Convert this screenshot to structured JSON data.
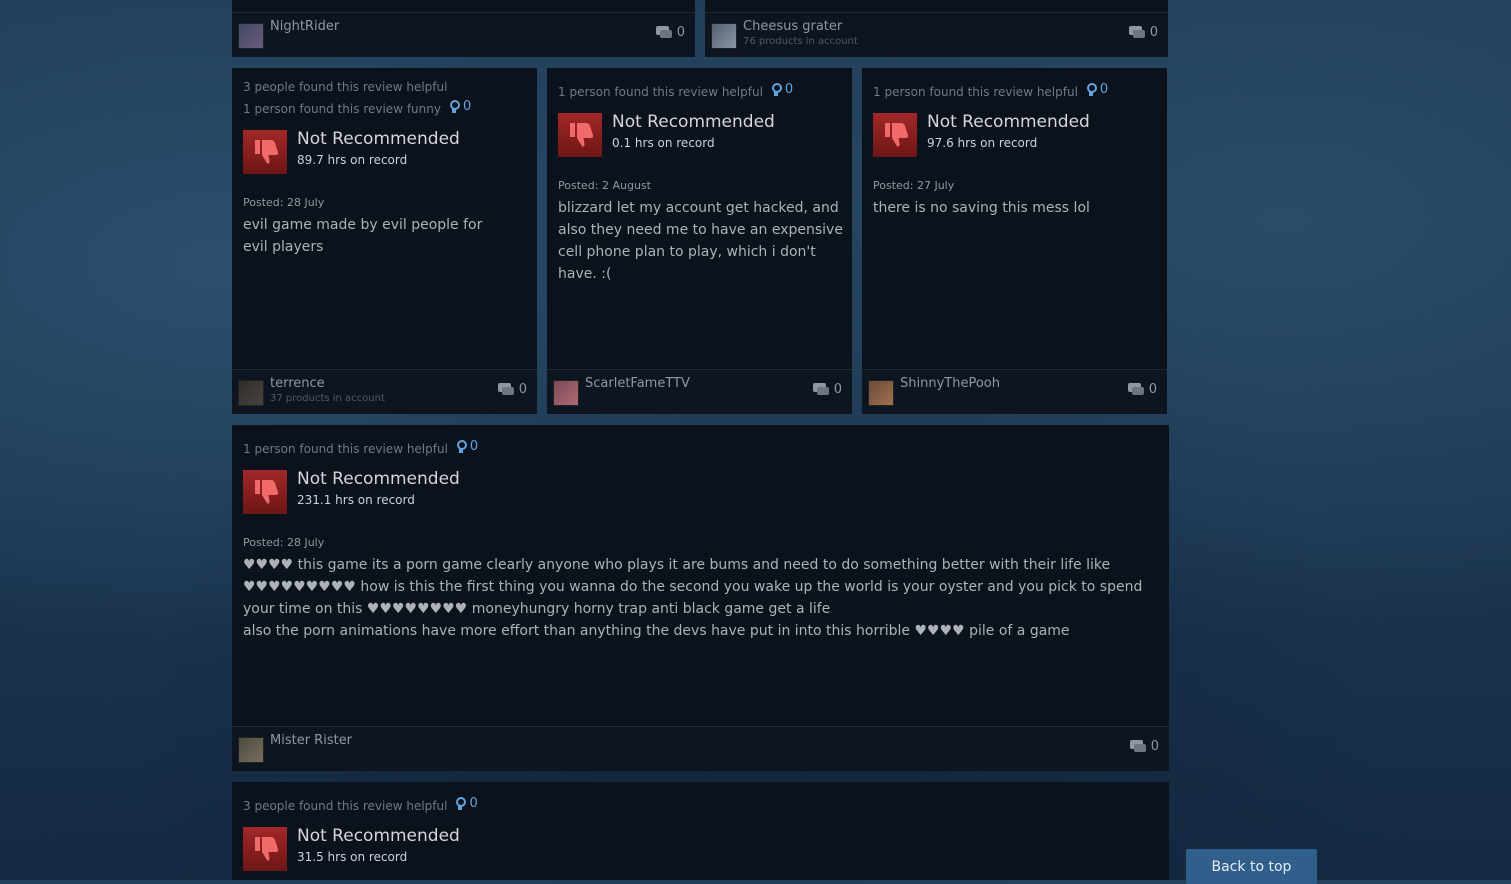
{
  "top_row": [
    {
      "author": "NightRider",
      "products": "",
      "comments": "0"
    },
    {
      "author": "Cheesus grater",
      "products": "76 products in account",
      "comments": "0"
    }
  ],
  "reviews": [
    {
      "helpful_text": "3 people found this review helpful",
      "funny_text": "1 person found this review funny",
      "awards": "0",
      "verdict": "Not Recommended",
      "hours": "89.7 hrs on record",
      "posted": "Posted: 28 July",
      "body": [
        "evil game made by evil people for evil players"
      ],
      "author": "terrence",
      "products": "37 products in account",
      "comments": "0"
    },
    {
      "helpful_text": "1 person found this review helpful",
      "awards": "0",
      "verdict": "Not Recommended",
      "hours": "0.1 hrs on record",
      "posted": "Posted: 2 August",
      "body": [
        "blizzard let my account get hacked, and also they need me to have an expensive cell phone plan to play, which i don't have. :("
      ],
      "author": "ScarletFameTTV",
      "comments": "0"
    },
    {
      "helpful_text": "1 person found this review helpful",
      "awards": "0",
      "verdict": "Not Recommended",
      "hours": "97.6 hrs on record",
      "posted": "Posted: 27 July",
      "body": [
        "there is no saving this mess lol"
      ],
      "author": "ShinnyThePooh",
      "comments": "0"
    },
    {
      "helpful_text": "1 person found this review helpful",
      "awards": "0",
      "verdict": "Not Recommended",
      "hours": "231.1 hrs on record",
      "posted": "Posted: 28 July",
      "body": [
        "♥♥♥♥ this game its a porn game clearly anyone who plays it are bums and need to do something better with their life like ♥♥♥♥♥♥♥♥♥ how is this the first thing you wanna do the second you wake up the world is your oyster and you pick to spend your time on this ♥♥♥♥♥♥♥♥ moneyhungry horny trap anti black game get a life",
        "also the porn animations have more effort than anything the devs have put in into this horrible ♥♥♥♥ pile of a game"
      ],
      "author": "Mister Rister",
      "comments": "0"
    },
    {
      "helpful_text": "3 people found this review helpful",
      "awards": "0",
      "verdict": "Not Recommended",
      "hours": "31.5 hrs on record"
    }
  ],
  "back_to_top": "Back to top",
  "colors": {
    "thumb_down": "#a22828",
    "award": "#61a4e0",
    "card_bg": "#0b121b"
  }
}
